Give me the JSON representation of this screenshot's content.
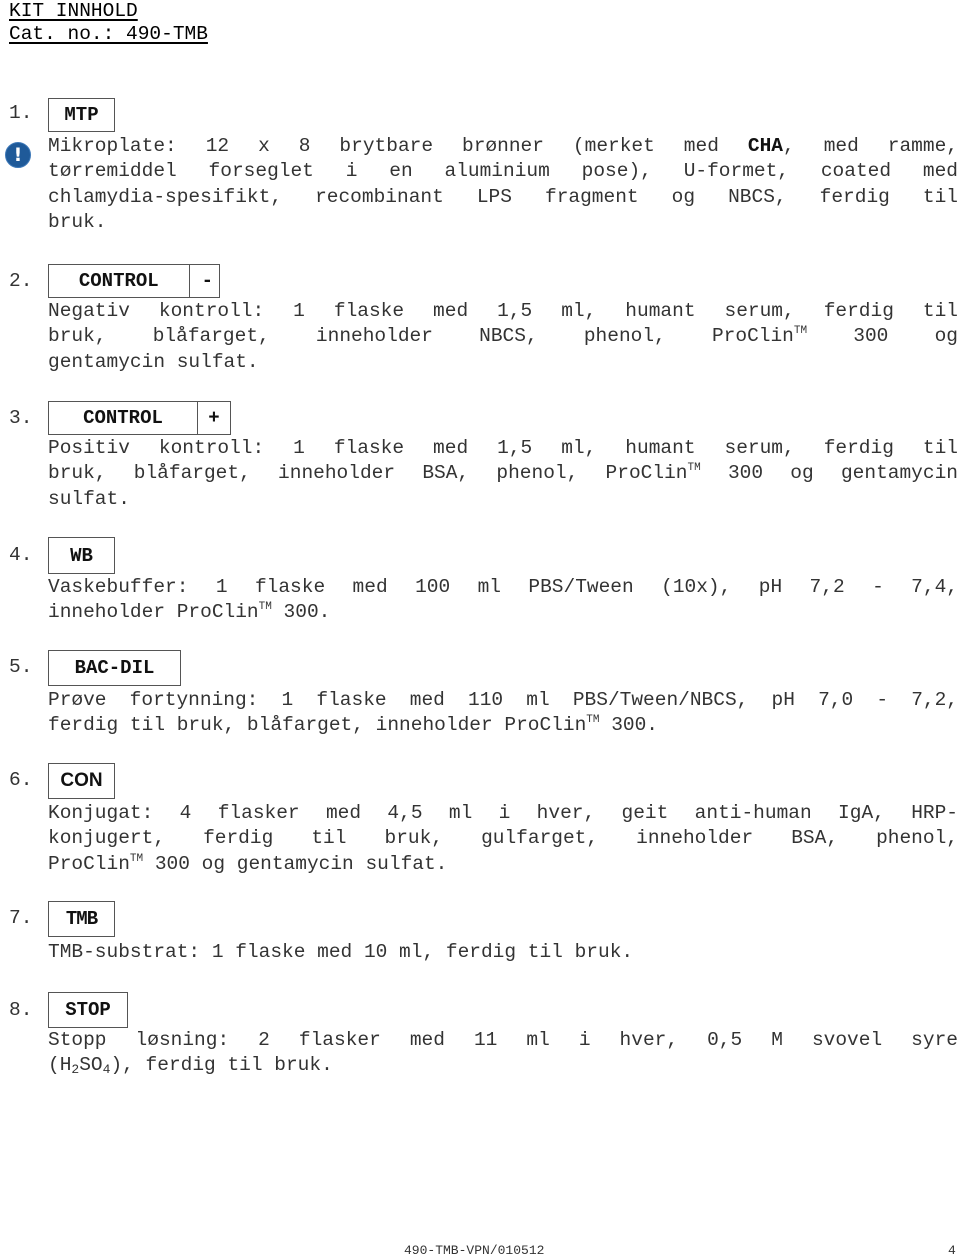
{
  "header": {
    "title": "KIT INNHOLD",
    "catalog": "Cat. no.: 490-TMB"
  },
  "items": [
    {
      "number": "1.",
      "label": [
        "MTP"
      ],
      "has_warning_icon": true,
      "warning_icon": "exclamation-circle-icon",
      "lines": [
        [
          "Mikroplate: 12 x 8 brytbare brønner (merket med ",
          "CHA",
          ", med ramme,"
        ],
        [
          "tørremiddel forseglet i en aluminium pose), U-formet, coated med"
        ],
        [
          "chlamydia-spesifikt, recombinant LPS fragment og NBCS, ferdig til"
        ],
        [
          "bruk."
        ]
      ]
    },
    {
      "number": "2.",
      "label": [
        "CONTROL",
        "-"
      ],
      "lines": [
        [
          "Negativ kontroll: 1 flaske med 1,5 ml, humant serum, ferdig til"
        ],
        [
          "bruk, blåfarget, inneholder NBCS, phenol, ProClin",
          "TM",
          " 300 og"
        ],
        [
          "gentamycin sulfat."
        ]
      ]
    },
    {
      "number": "3.",
      "label": [
        "CONTROL",
        "+"
      ],
      "lines": [
        [
          "Positiv kontroll: 1 flaske med 1,5 ml, humant serum, ferdig til"
        ],
        [
          "bruk, blåfarget, inneholder BSA, phenol, ProClin",
          "TM",
          " 300 og gentamycin"
        ],
        [
          "sulfat."
        ]
      ]
    },
    {
      "number": "4.",
      "label": [
        "WB"
      ],
      "lines": [
        [
          "Vaskebuffer: 1 flaske med 100 ml PBS/Tween (10x), pH 7,2 - 7,4,"
        ],
        [
          "inneholder ProClin",
          "TM",
          " 300."
        ]
      ]
    },
    {
      "number": "5.",
      "label": [
        "BAC-DIL"
      ],
      "lines": [
        [
          "Prøve fortynning: 1 flaske med 110 ml PBS/Tween/NBCS, pH 7,0 - 7,2,"
        ],
        [
          "ferdig til bruk, blåfarget, inneholder ProClin",
          "TM",
          " 300."
        ]
      ]
    },
    {
      "number": "6.",
      "label": [
        "CON"
      ],
      "lines": [
        [
          "Konjugat: 4 flasker med 4,5 ml i hver, geit anti-human IgA, HRP-"
        ],
        [
          "konjugert, ferdig til bruk, gulfarget, inneholder BSA, phenol,"
        ],
        [
          "ProClin",
          "TM",
          " 300 og gentamycin sulfat."
        ]
      ]
    },
    {
      "number": "7.",
      "label": [
        "TMB"
      ],
      "lines": [
        [
          "TMB-substrat: 1 flaske med 10 ml, ferdig til bruk."
        ]
      ]
    },
    {
      "number": "8.",
      "label": [
        "STOP"
      ],
      "lines": [
        [
          "Stopp løsning: 2 flasker med 11 ml i hver, 0,5 M svovel syre"
        ],
        [
          "(H",
          "2",
          "SO",
          "4",
          "), ferdig til bruk."
        ]
      ]
    }
  ],
  "footer": {
    "doc_code": "490-TMB-VPN/010512",
    "page_number": "4"
  }
}
